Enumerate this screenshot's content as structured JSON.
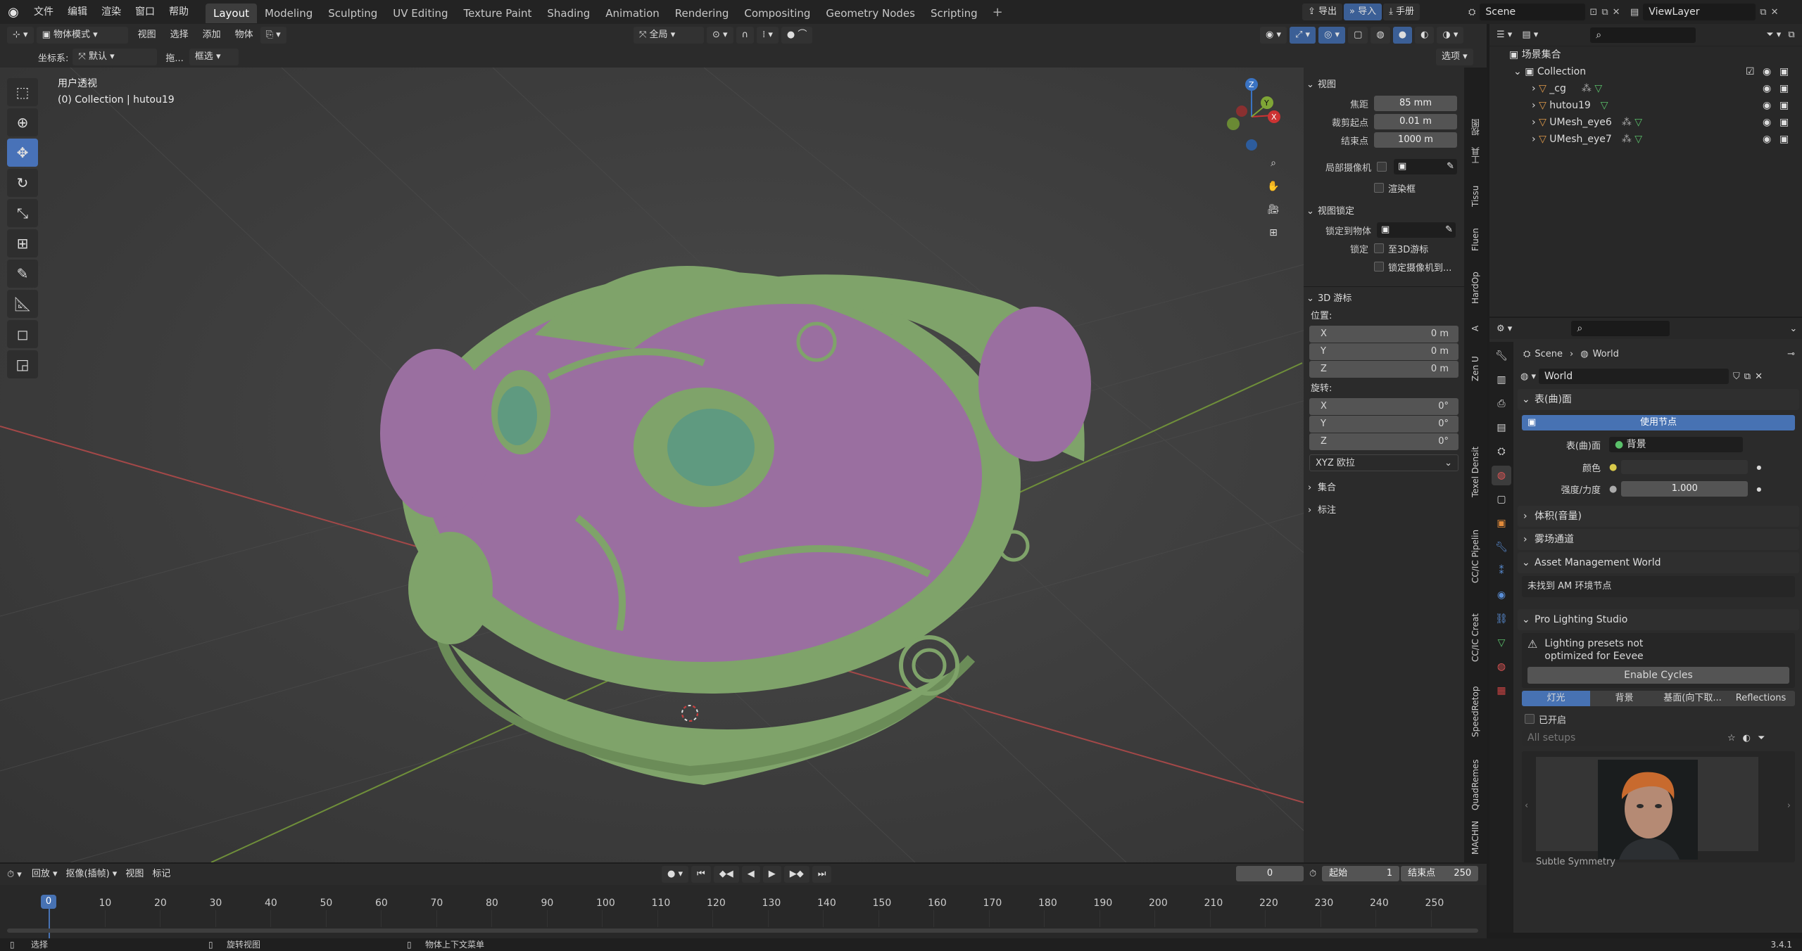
{
  "topbar": {
    "menus": [
      "文件",
      "编辑",
      "渲染",
      "窗口",
      "帮助"
    ],
    "workspace_tabs": [
      "Layout",
      "Modeling",
      "Sculpting",
      "UV Editing",
      "Texture Paint",
      "Shading",
      "Animation",
      "Rendering",
      "Compositing",
      "Geometry Nodes",
      "Scripting"
    ],
    "active_tab": "Layout",
    "plus": "+",
    "export_label": "导出",
    "import_label": "导入",
    "manual_label": "手册",
    "scene_name": "Scene",
    "view_layer": "ViewLayer"
  },
  "viewport_header": {
    "mode": "物体模式",
    "menus": [
      "视图",
      "选择",
      "添加",
      "物体"
    ],
    "transform_orientation": "全局",
    "options": "选项"
  },
  "tool_settings": {
    "coord_label": "坐标系:",
    "coord_value": "默认",
    "drag_label": "拖...",
    "select_mode": "框选"
  },
  "viewport_info": {
    "view_name": "用户透视",
    "collection_info": "(0) Collection | hutou19"
  },
  "gizmo": {
    "z": "Z",
    "y": "Y",
    "x": "X"
  },
  "npanel": {
    "view_section": "视图",
    "focal_label": "焦距",
    "focal_value": "85 mm",
    "clip_start_label": "裁剪起点",
    "clip_start_value": "0.01 m",
    "clip_end_label": "结束点",
    "clip_end_value": "1000 m",
    "local_camera_label": "局部摄像机",
    "render_region_label": "渲染框",
    "view_lock_section": "视图锁定",
    "lock_to_object_label": "锁定到物体",
    "lock_label": "锁定",
    "lock_to_cursor": "至3D游标",
    "lock_camera": "锁定摄像机到...",
    "cursor_section": "3D 游标",
    "location_label": "位置:",
    "loc_x": "0 m",
    "loc_y": "0 m",
    "loc_z": "0 m",
    "rotation_label": "旋转:",
    "rot_x": "0°",
    "rot_y": "0°",
    "rot_z": "0°",
    "rotation_mode": "XYZ 欧拉",
    "collection_section": "集合",
    "annotation_section": "标注",
    "axis_x": "X",
    "axis_y": "Y",
    "axis_z": "Z"
  },
  "vertical_tabs": [
    "Tissu",
    "Fluen",
    "HardOp",
    "A",
    "Zen U",
    "Texel Densit",
    "CC/IC Pipelin",
    "CC/IC Creat",
    "SpeedRetop",
    "QuadRemes",
    "MACHIN"
  ],
  "outliner": {
    "root": "场景集合",
    "collection": "Collection",
    "objects": [
      "_cg",
      "hutou19",
      "UMesh_eye6",
      "UMesh_eye7"
    ]
  },
  "properties": {
    "breadcrumb_scene": "Scene",
    "breadcrumb_world": "World",
    "world_name": "World",
    "surface_section": "表(曲)面",
    "use_nodes": "使用节点",
    "surface_label": "表(曲)面",
    "surface_value": "背景",
    "color_label": "颜色",
    "strength_label": "强度/力度",
    "strength_value": "1.000",
    "volume_section": "体积(音量)",
    "mist_section": "雾场通道",
    "asset_section": "Asset Management World",
    "asset_msg": "未找到 AM 环境节点",
    "pls_section": "Pro Lighting Studio",
    "pls_warning_1": "Lighting presets not",
    "pls_warning_2": "optimized for Eevee",
    "enable_cycles": "Enable Cycles",
    "pls_tabs": [
      "灯光",
      "背景",
      "基面(向下取...",
      "Reflections"
    ],
    "enabled_label": "已开启",
    "setups_placeholder": "All setups",
    "preset_name": "Subtle Symmetry"
  },
  "timeline": {
    "menus": [
      "回放",
      "抠像(插帧)",
      "视图",
      "标记"
    ],
    "current_frame": "0",
    "start_label": "起始",
    "start_value": "1",
    "end_label": "结束点",
    "end_value": "250",
    "ticks": [
      "0",
      "10",
      "20",
      "30",
      "40",
      "50",
      "60",
      "70",
      "80",
      "90",
      "100",
      "110",
      "120",
      "130",
      "140",
      "150",
      "160",
      "170",
      "180",
      "190",
      "200",
      "210",
      "220",
      "230",
      "240",
      "250"
    ]
  },
  "statusbar": {
    "select": "选择",
    "rotate_view": "旋转视图",
    "context_menu": "物体上下文菜单",
    "version": "3.4.1"
  },
  "colors": {
    "accent": "#4772b3",
    "mesh_green": "#7fa36a",
    "mesh_purple": "#9a6fa0"
  }
}
